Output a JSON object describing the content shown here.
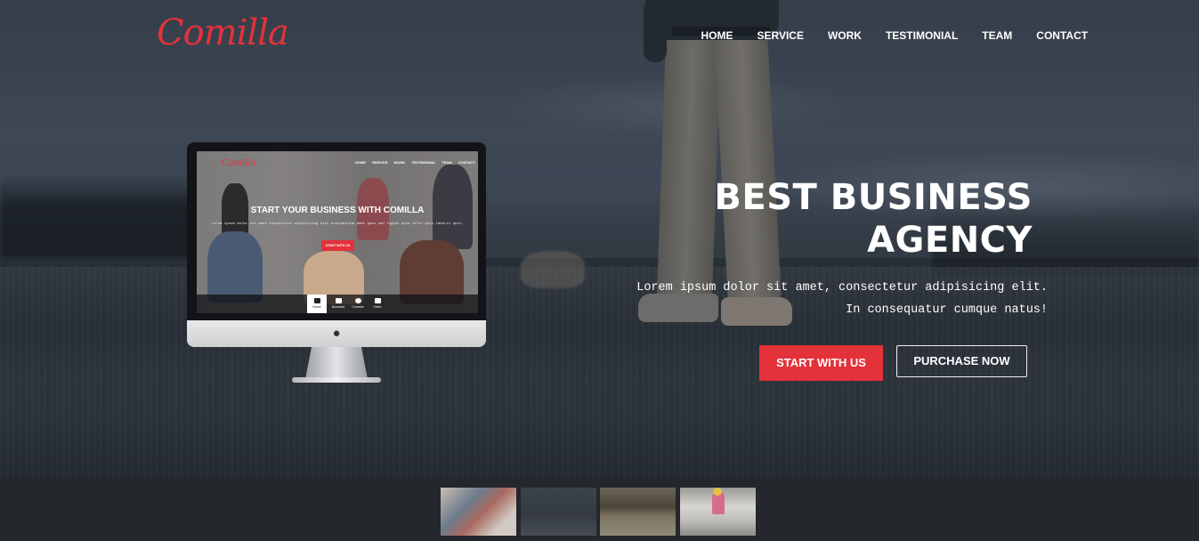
{
  "brand": {
    "logo_text": "Comilla",
    "accent_color": "#e3323a"
  },
  "nav": {
    "items": [
      {
        "label": "HOME"
      },
      {
        "label": "SERVICE"
      },
      {
        "label": "WORK"
      },
      {
        "label": "TESTIMONIAL"
      },
      {
        "label": "TEAM"
      },
      {
        "label": "CONTACT"
      }
    ]
  },
  "hero": {
    "title_line1": "BEST BUSINESS",
    "title_line2": "AGENCY",
    "subtitle": "Lorem ipsum dolor sit amet, consectetur adipisicing elit. In consequatur cumque natus!",
    "primary_button": "START WITH US",
    "secondary_button": "PURCHASE NOW"
  },
  "monitor_preview": {
    "logo_text": "Comilla",
    "nav_items": [
      "HOME",
      "SERVICE",
      "WORK",
      "TESTIMONIAL",
      "TEAM",
      "CONTACT"
    ],
    "title": "START YOUR BUSINESS WITH COMILLA",
    "text": "Lorem ipsum dolor sit amet consectetur adipisicing elit Accusantium amet quos sed fugiat quia velit quis laboris quis.",
    "button": "START WITH US",
    "tabs": [
      {
        "label": "Home",
        "icon": "home-icon"
      },
      {
        "label": "Business",
        "icon": "briefcase-icon"
      },
      {
        "label": "Connect",
        "icon": "globe-icon"
      },
      {
        "label": "Video",
        "icon": "video-icon"
      }
    ],
    "stand_logo_icon": "apple-icon"
  },
  "slider_thumbnails": [
    {
      "name": "thumb-team-meeting"
    },
    {
      "name": "thumb-walker-landscape"
    },
    {
      "name": "thumb-street-scene"
    },
    {
      "name": "thumb-girl-on-rock"
    }
  ]
}
